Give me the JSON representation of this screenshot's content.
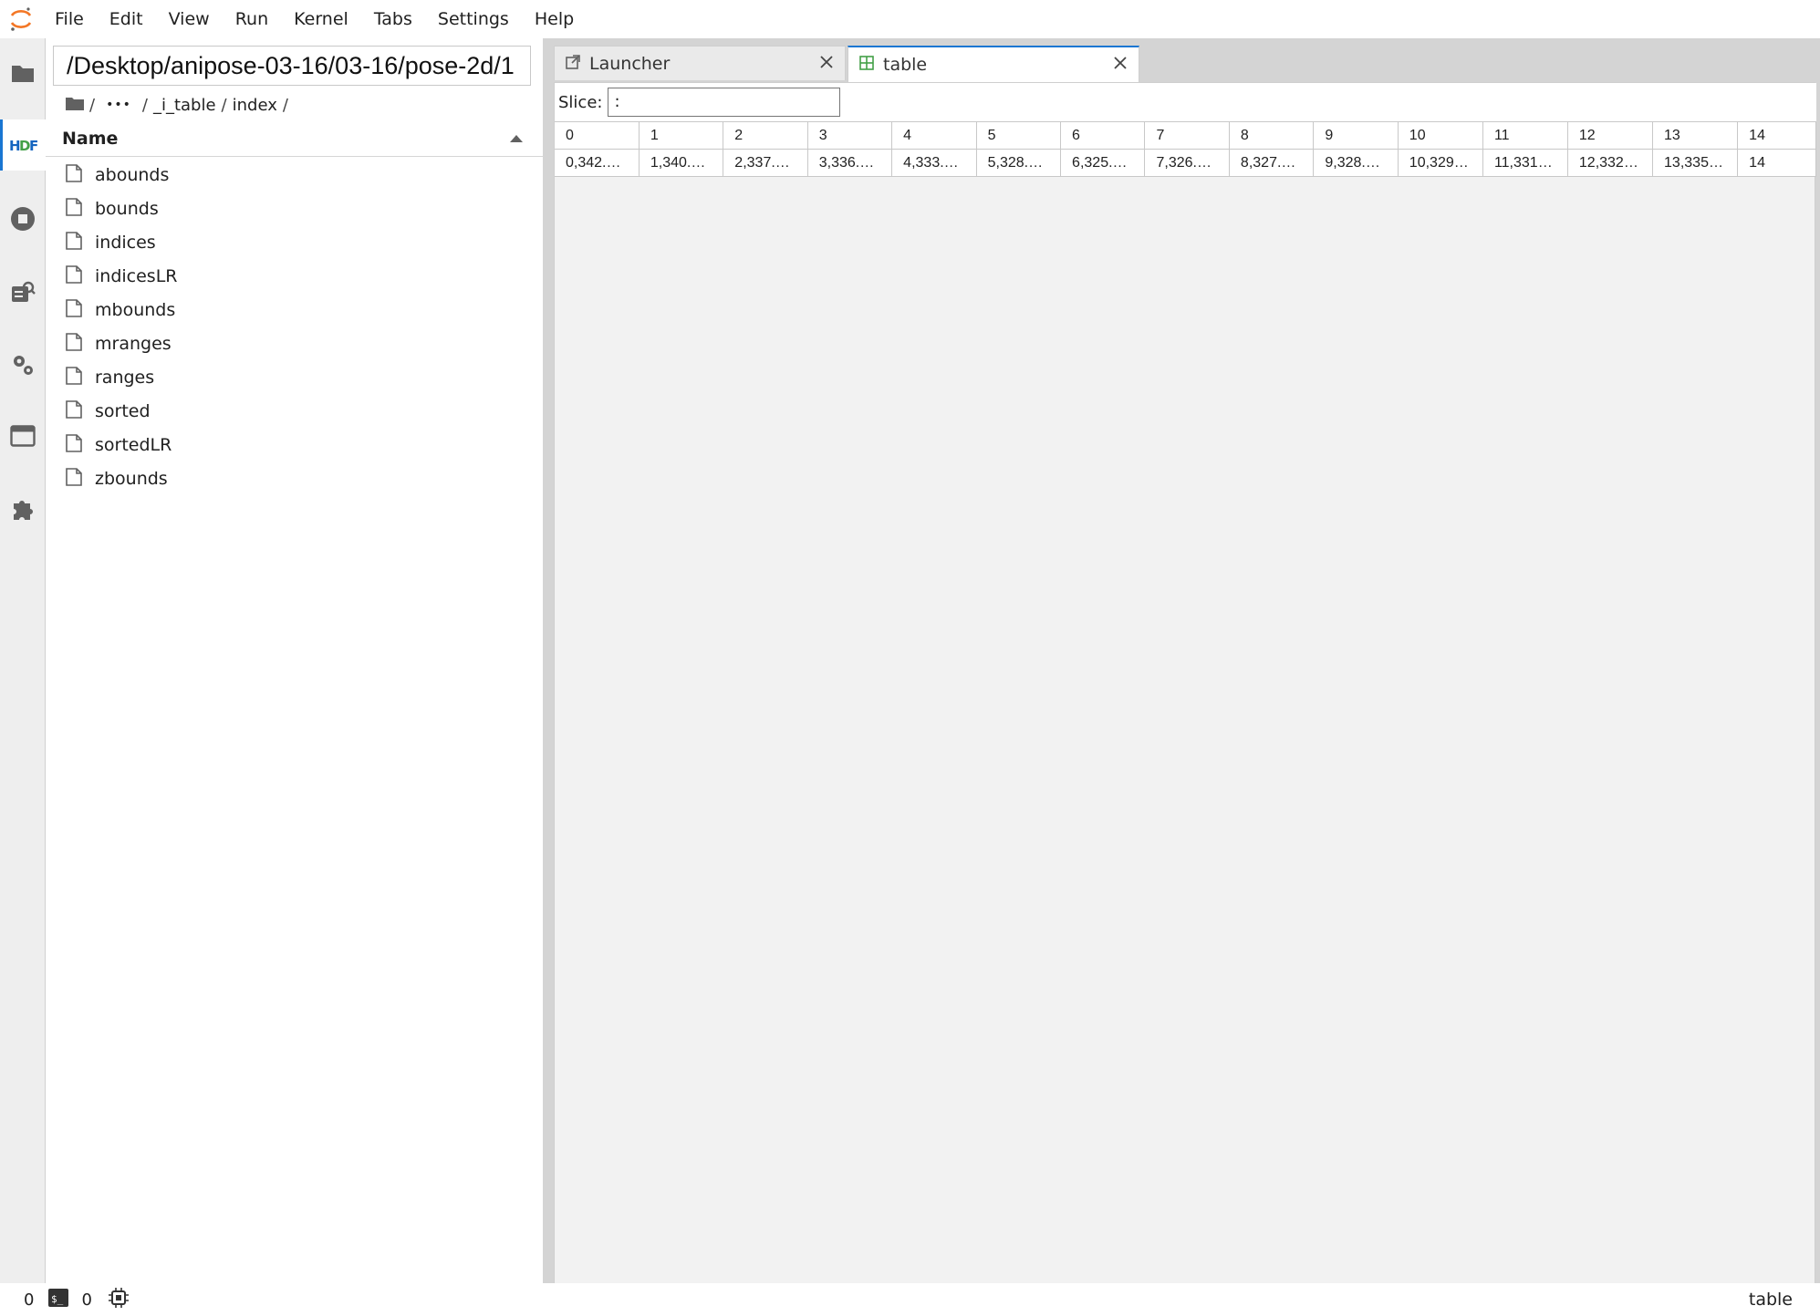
{
  "menu": [
    "File",
    "Edit",
    "View",
    "Run",
    "Kernel",
    "Tabs",
    "Settings",
    "Help"
  ],
  "activity_bar": [
    {
      "name": "folder-icon",
      "active": false
    },
    {
      "name": "hdf-icon",
      "active": true
    },
    {
      "name": "running-icon",
      "active": false
    },
    {
      "name": "commands-icon",
      "active": false
    },
    {
      "name": "property-inspector-icon",
      "active": false
    },
    {
      "name": "tabs-icon",
      "active": false
    },
    {
      "name": "extensions-icon",
      "active": false
    }
  ],
  "file_browser": {
    "path": "/Desktop/anipose-03-16/03-16/pose-2d/1",
    "breadcrumbs": [
      "/",
      "•••",
      "/",
      "_i_table",
      "/",
      "index",
      "/"
    ],
    "column_header": "Name",
    "files": [
      "abounds",
      "bounds",
      "indices",
      "indicesLR",
      "mbounds",
      "mranges",
      "ranges",
      "sorted",
      "sortedLR",
      "zbounds"
    ]
  },
  "tabs": [
    {
      "label": "Launcher",
      "icon": "launch-icon",
      "current": false
    },
    {
      "label": "table",
      "icon": "grid-icon",
      "current": true
    }
  ],
  "slice": {
    "label": "Slice:",
    "value": ":"
  },
  "table": {
    "columns": [
      "0",
      "1",
      "2",
      "3",
      "4",
      "5",
      "6",
      "7",
      "8",
      "9",
      "10",
      "11",
      "12",
      "13",
      "14"
    ],
    "rows": [
      [
        "0,342.…",
        "1,340.…",
        "2,337.…",
        "3,336.…",
        "4,333.…",
        "5,328.…",
        "6,325.…",
        "7,326.…",
        "8,327.…",
        "9,328.…",
        "10,329…",
        "11,331…",
        "12,332…",
        "13,335…",
        "14"
      ]
    ]
  },
  "status": {
    "kernels": "0",
    "terminals": "0",
    "right_label": "table"
  },
  "colors": {
    "accent": "#1976d2",
    "logo": "#f37726",
    "hdf_blue": "#1565c0",
    "hdf_green": "#43a047"
  }
}
